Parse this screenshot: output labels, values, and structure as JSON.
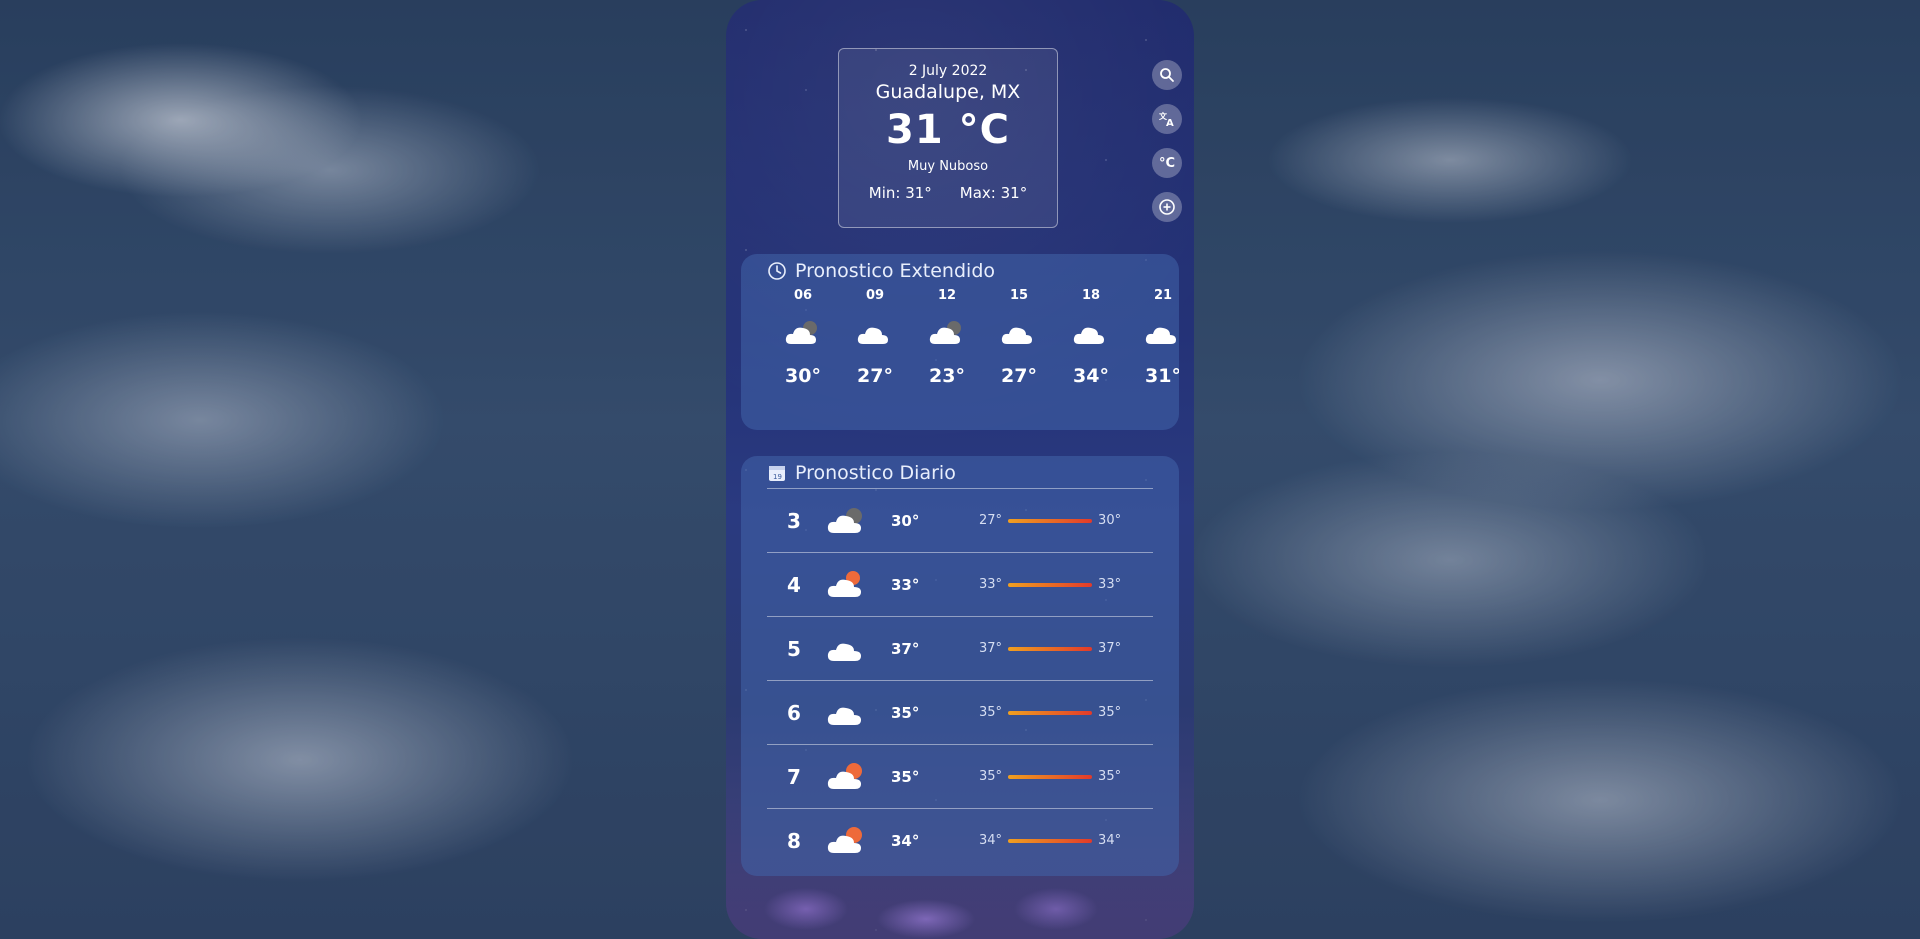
{
  "current": {
    "date": "2 July 2022",
    "city": "Guadalupe, MX",
    "temp": "31 °C",
    "description": "Muy Nuboso",
    "min": "Min: 31°",
    "max": "Max: 31°"
  },
  "side_buttons": {
    "search_icon": "search-icon",
    "translate_icon": "translate-icon",
    "unit_label": "°C",
    "add_icon": "add-circle-icon"
  },
  "hourly": {
    "title": "Pronostico Extendido",
    "icon": "clock-icon",
    "items": [
      {
        "hour": "06",
        "temp": "30°",
        "icon": "cloud-night-icon"
      },
      {
        "hour": "09",
        "temp": "27°",
        "icon": "cloud-icon"
      },
      {
        "hour": "12",
        "temp": "23°",
        "icon": "cloud-night-icon"
      },
      {
        "hour": "15",
        "temp": "27°",
        "icon": "cloud-icon"
      },
      {
        "hour": "18",
        "temp": "34°",
        "icon": "cloud-icon"
      },
      {
        "hour": "21",
        "temp": "31°",
        "icon": "cloud-icon"
      }
    ]
  },
  "daily": {
    "title": "Pronostico Diario",
    "icon": "calendar-icon",
    "items": [
      {
        "day": "3",
        "max": "30°",
        "low": "27°",
        "high": "30°",
        "icon": "cloud-night-icon"
      },
      {
        "day": "4",
        "max": "33°",
        "low": "33°",
        "high": "33°",
        "icon": "cloud-sun-icon"
      },
      {
        "day": "5",
        "max": "37°",
        "low": "37°",
        "high": "37°",
        "icon": "cloud-icon"
      },
      {
        "day": "6",
        "max": "35°",
        "low": "35°",
        "high": "35°",
        "icon": "cloud-icon"
      },
      {
        "day": "7",
        "max": "35°",
        "low": "35°",
        "high": "35°",
        "icon": "cloud-sun-icon"
      },
      {
        "day": "8",
        "max": "34°",
        "low": "34°",
        "high": "34°",
        "icon": "cloud-sun-icon"
      }
    ]
  },
  "colors": {
    "bar_start": "#f0a020",
    "bar_end": "#e23a2a",
    "panel": "#4164aa"
  }
}
